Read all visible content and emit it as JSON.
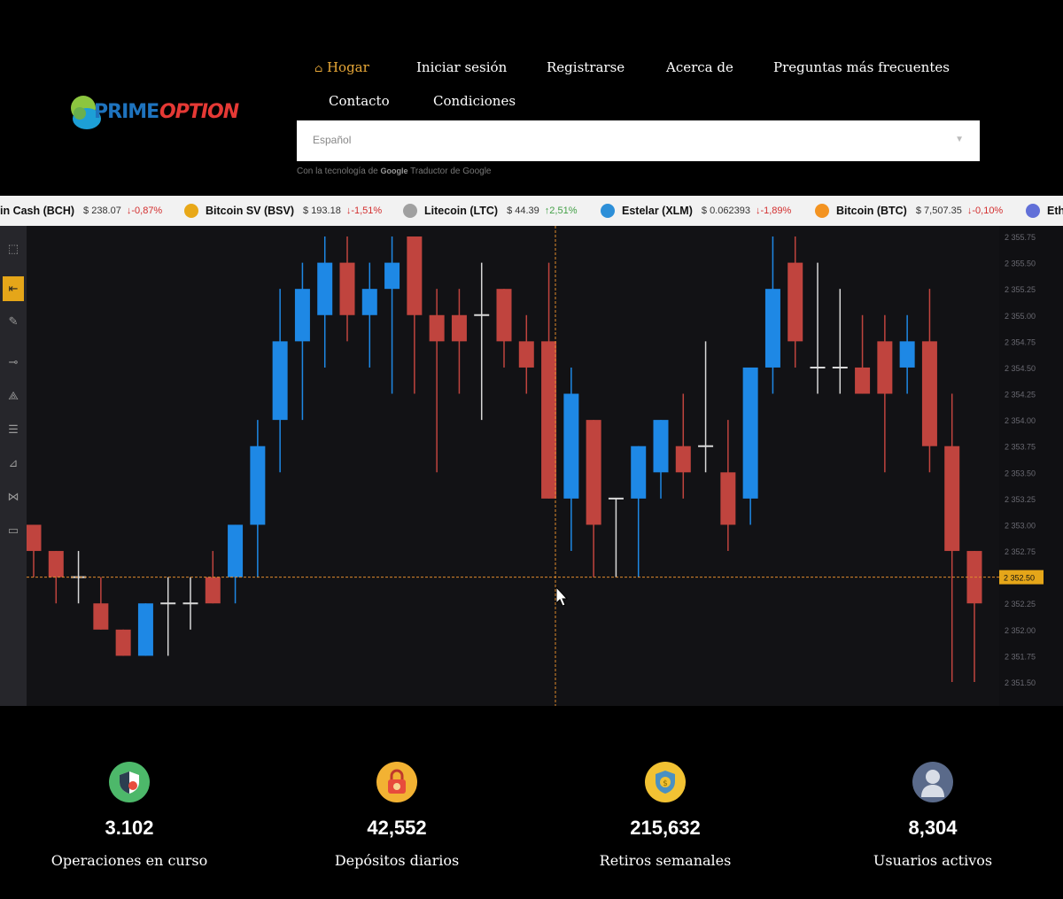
{
  "brand": {
    "name_part1": "PRIME",
    "name_part2": "OPTION"
  },
  "nav": {
    "home_icon": "home-icon",
    "items": [
      "Hogar",
      "Iniciar sesión",
      "Registrarse",
      "Acerca de",
      "Preguntas más frecuentes",
      "Contacto",
      "Condiciones"
    ]
  },
  "language": {
    "selected": "Español",
    "powered_prefix": "Con la tecnología de",
    "google": "Google",
    "translator": "Traductor de Google"
  },
  "ticker": [
    {
      "name": "in Cash (BCH)",
      "price": "$ 238.07",
      "change": "-0,87%",
      "dir": "down",
      "color": ""
    },
    {
      "name": "Bitcoin SV (BSV)",
      "price": "$ 193.18",
      "change": "-1,51%",
      "dir": "down",
      "color": "#e8a818"
    },
    {
      "name": "Litecoin (LTC)",
      "price": "$ 44.39",
      "change": "2,51%",
      "dir": "up",
      "color": "#a0a0a0"
    },
    {
      "name": "Estelar (XLM)",
      "price": "$ 0.062393",
      "change": "-1,89%",
      "dir": "down",
      "color": "#2d8fd8"
    },
    {
      "name": "Bitcoin (BTC)",
      "price": "$ 7,507.35",
      "change": "-0,10%",
      "dir": "down",
      "color": "#f39321"
    },
    {
      "name": "Eth",
      "price": "",
      "change": "",
      "dir": "",
      "color": "#6270d8"
    }
  ],
  "chart_data": {
    "type": "candlestick",
    "y_ticks": [
      "2 355.75",
      "2 355.50",
      "2 355.25",
      "2 355.00",
      "2 354.75",
      "2 354.50",
      "2 354.25",
      "2 354.00",
      "2 353.75",
      "2 353.50",
      "2 353.25",
      "2 353.00",
      "2 352.75",
      "2 352.50",
      "2 352.25",
      "2 352.00",
      "2 351.75",
      "2 351.50"
    ],
    "current_price": "2 352.50",
    "ylim": [
      2351.5,
      2355.75
    ],
    "candles": [
      {
        "o": 2353.0,
        "c": 2352.75,
        "h": 2353.0,
        "l": 2352.5
      },
      {
        "o": 2352.75,
        "c": 2352.5,
        "h": 2352.75,
        "l": 2352.25
      },
      {
        "o": 2352.5,
        "c": 2352.5,
        "h": 2352.75,
        "l": 2352.25
      },
      {
        "o": 2352.25,
        "c": 2352.0,
        "h": 2352.5,
        "l": 2352.0
      },
      {
        "o": 2352.0,
        "c": 2351.75,
        "h": 2352.0,
        "l": 2351.75
      },
      {
        "o": 2351.75,
        "c": 2352.25,
        "h": 2352.25,
        "l": 2351.75
      },
      {
        "o": 2352.25,
        "c": 2352.25,
        "h": 2352.5,
        "l": 2351.75
      },
      {
        "o": 2352.25,
        "c": 2352.25,
        "h": 2352.5,
        "l": 2352.0
      },
      {
        "o": 2352.5,
        "c": 2352.25,
        "h": 2352.75,
        "l": 2352.25
      },
      {
        "o": 2352.5,
        "c": 2353.0,
        "h": 2353.0,
        "l": 2352.25
      },
      {
        "o": 2353.0,
        "c": 2353.75,
        "h": 2354.0,
        "l": 2352.5
      },
      {
        "o": 2354.0,
        "c": 2354.75,
        "h": 2355.25,
        "l": 2353.5
      },
      {
        "o": 2354.75,
        "c": 2355.25,
        "h": 2355.5,
        "l": 2354.0
      },
      {
        "o": 2355.0,
        "c": 2355.5,
        "h": 2355.75,
        "l": 2354.5
      },
      {
        "o": 2355.5,
        "c": 2355.0,
        "h": 2355.75,
        "l": 2354.75
      },
      {
        "o": 2355.0,
        "c": 2355.25,
        "h": 2355.5,
        "l": 2354.5
      },
      {
        "o": 2355.25,
        "c": 2355.5,
        "h": 2355.75,
        "l": 2354.25
      },
      {
        "o": 2355.75,
        "c": 2355.0,
        "h": 2355.75,
        "l": 2354.25
      },
      {
        "o": 2355.0,
        "c": 2354.75,
        "h": 2355.25,
        "l": 2353.5
      },
      {
        "o": 2355.0,
        "c": 2354.75,
        "h": 2355.25,
        "l": 2354.25
      },
      {
        "o": 2355.0,
        "c": 2355.0,
        "h": 2355.5,
        "l": 2354.0
      },
      {
        "o": 2355.25,
        "c": 2354.75,
        "h": 2355.25,
        "l": 2354.5
      },
      {
        "o": 2354.75,
        "c": 2354.5,
        "h": 2355.0,
        "l": 2354.25
      },
      {
        "o": 2354.75,
        "c": 2353.25,
        "h": 2355.5,
        "l": 2353.25
      },
      {
        "o": 2353.25,
        "c": 2354.25,
        "h": 2354.5,
        "l": 2352.75
      },
      {
        "o": 2354.0,
        "c": 2353.0,
        "h": 2354.0,
        "l": 2352.5
      },
      {
        "o": 2353.25,
        "c": 2353.25,
        "h": 2353.25,
        "l": 2352.5
      },
      {
        "o": 2353.25,
        "c": 2353.75,
        "h": 2353.75,
        "l": 2352.5
      },
      {
        "o": 2353.5,
        "c": 2354.0,
        "h": 2354.0,
        "l": 2353.25
      },
      {
        "o": 2353.75,
        "c": 2353.5,
        "h": 2354.25,
        "l": 2353.25
      },
      {
        "o": 2353.75,
        "c": 2353.75,
        "h": 2354.75,
        "l": 2353.5
      },
      {
        "o": 2353.5,
        "c": 2353.0,
        "h": 2354.0,
        "l": 2352.75
      },
      {
        "o": 2353.25,
        "c": 2354.5,
        "h": 2354.5,
        "l": 2353.0
      },
      {
        "o": 2354.5,
        "c": 2355.25,
        "h": 2355.75,
        "l": 2354.25
      },
      {
        "o": 2355.5,
        "c": 2354.75,
        "h": 2355.75,
        "l": 2354.5
      },
      {
        "o": 2354.5,
        "c": 2354.5,
        "h": 2355.5,
        "l": 2354.25
      },
      {
        "o": 2354.5,
        "c": 2354.5,
        "h": 2355.25,
        "l": 2354.25
      },
      {
        "o": 2354.5,
        "c": 2354.25,
        "h": 2355.0,
        "l": 2354.25
      },
      {
        "o": 2354.75,
        "c": 2354.25,
        "h": 2355.0,
        "l": 2353.5
      },
      {
        "o": 2354.5,
        "c": 2354.75,
        "h": 2355.0,
        "l": 2354.25
      },
      {
        "o": 2354.75,
        "c": 2353.75,
        "h": 2355.25,
        "l": 2353.5
      },
      {
        "o": 2353.75,
        "c": 2352.75,
        "h": 2354.25,
        "l": 2351.5
      },
      {
        "o": 2352.75,
        "c": 2352.25,
        "h": 2352.75,
        "l": 2351.5
      }
    ]
  },
  "stats": [
    {
      "value": "3.102",
      "label": "Operaciones en curso",
      "icon": "shield-icon",
      "color": "#4db86a"
    },
    {
      "value": "42,552",
      "label": "Depósitos diarios",
      "icon": "lock-icon",
      "color": "#f2b233"
    },
    {
      "value": "215,632",
      "label": "Retiros semanales",
      "icon": "dollar-shield-icon",
      "color": "#f2c233"
    },
    {
      "value": "8,304",
      "label": "Usuarios activos",
      "icon": "user-icon",
      "color": "#5a6a8a"
    }
  ]
}
